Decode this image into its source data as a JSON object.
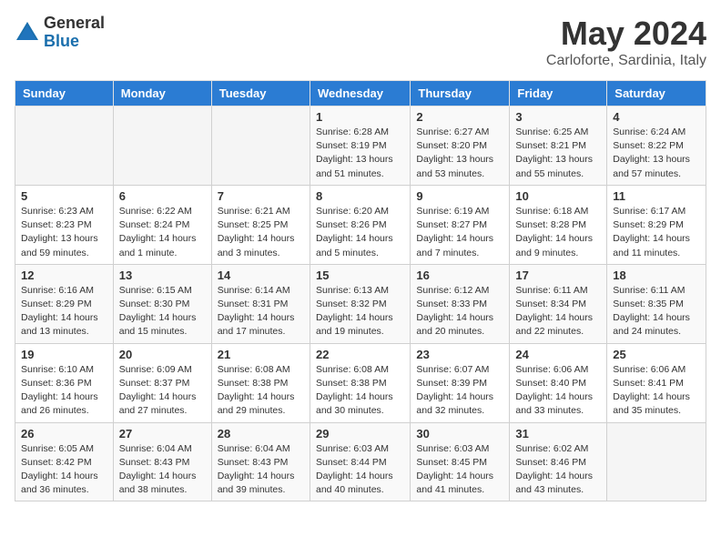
{
  "logo": {
    "general": "General",
    "blue": "Blue"
  },
  "header": {
    "month": "May 2024",
    "location": "Carloforte, Sardinia, Italy"
  },
  "weekdays": [
    "Sunday",
    "Monday",
    "Tuesday",
    "Wednesday",
    "Thursday",
    "Friday",
    "Saturday"
  ],
  "weeks": [
    [
      {
        "day": "",
        "info": ""
      },
      {
        "day": "",
        "info": ""
      },
      {
        "day": "",
        "info": ""
      },
      {
        "day": "1",
        "info": "Sunrise: 6:28 AM\nSunset: 8:19 PM\nDaylight: 13 hours\nand 51 minutes."
      },
      {
        "day": "2",
        "info": "Sunrise: 6:27 AM\nSunset: 8:20 PM\nDaylight: 13 hours\nand 53 minutes."
      },
      {
        "day": "3",
        "info": "Sunrise: 6:25 AM\nSunset: 8:21 PM\nDaylight: 13 hours\nand 55 minutes."
      },
      {
        "day": "4",
        "info": "Sunrise: 6:24 AM\nSunset: 8:22 PM\nDaylight: 13 hours\nand 57 minutes."
      }
    ],
    [
      {
        "day": "5",
        "info": "Sunrise: 6:23 AM\nSunset: 8:23 PM\nDaylight: 13 hours\nand 59 minutes."
      },
      {
        "day": "6",
        "info": "Sunrise: 6:22 AM\nSunset: 8:24 PM\nDaylight: 14 hours\nand 1 minute."
      },
      {
        "day": "7",
        "info": "Sunrise: 6:21 AM\nSunset: 8:25 PM\nDaylight: 14 hours\nand 3 minutes."
      },
      {
        "day": "8",
        "info": "Sunrise: 6:20 AM\nSunset: 8:26 PM\nDaylight: 14 hours\nand 5 minutes."
      },
      {
        "day": "9",
        "info": "Sunrise: 6:19 AM\nSunset: 8:27 PM\nDaylight: 14 hours\nand 7 minutes."
      },
      {
        "day": "10",
        "info": "Sunrise: 6:18 AM\nSunset: 8:28 PM\nDaylight: 14 hours\nand 9 minutes."
      },
      {
        "day": "11",
        "info": "Sunrise: 6:17 AM\nSunset: 8:29 PM\nDaylight: 14 hours\nand 11 minutes."
      }
    ],
    [
      {
        "day": "12",
        "info": "Sunrise: 6:16 AM\nSunset: 8:29 PM\nDaylight: 14 hours\nand 13 minutes."
      },
      {
        "day": "13",
        "info": "Sunrise: 6:15 AM\nSunset: 8:30 PM\nDaylight: 14 hours\nand 15 minutes."
      },
      {
        "day": "14",
        "info": "Sunrise: 6:14 AM\nSunset: 8:31 PM\nDaylight: 14 hours\nand 17 minutes."
      },
      {
        "day": "15",
        "info": "Sunrise: 6:13 AM\nSunset: 8:32 PM\nDaylight: 14 hours\nand 19 minutes."
      },
      {
        "day": "16",
        "info": "Sunrise: 6:12 AM\nSunset: 8:33 PM\nDaylight: 14 hours\nand 20 minutes."
      },
      {
        "day": "17",
        "info": "Sunrise: 6:11 AM\nSunset: 8:34 PM\nDaylight: 14 hours\nand 22 minutes."
      },
      {
        "day": "18",
        "info": "Sunrise: 6:11 AM\nSunset: 8:35 PM\nDaylight: 14 hours\nand 24 minutes."
      }
    ],
    [
      {
        "day": "19",
        "info": "Sunrise: 6:10 AM\nSunset: 8:36 PM\nDaylight: 14 hours\nand 26 minutes."
      },
      {
        "day": "20",
        "info": "Sunrise: 6:09 AM\nSunset: 8:37 PM\nDaylight: 14 hours\nand 27 minutes."
      },
      {
        "day": "21",
        "info": "Sunrise: 6:08 AM\nSunset: 8:38 PM\nDaylight: 14 hours\nand 29 minutes."
      },
      {
        "day": "22",
        "info": "Sunrise: 6:08 AM\nSunset: 8:38 PM\nDaylight: 14 hours\nand 30 minutes."
      },
      {
        "day": "23",
        "info": "Sunrise: 6:07 AM\nSunset: 8:39 PM\nDaylight: 14 hours\nand 32 minutes."
      },
      {
        "day": "24",
        "info": "Sunrise: 6:06 AM\nSunset: 8:40 PM\nDaylight: 14 hours\nand 33 minutes."
      },
      {
        "day": "25",
        "info": "Sunrise: 6:06 AM\nSunset: 8:41 PM\nDaylight: 14 hours\nand 35 minutes."
      }
    ],
    [
      {
        "day": "26",
        "info": "Sunrise: 6:05 AM\nSunset: 8:42 PM\nDaylight: 14 hours\nand 36 minutes."
      },
      {
        "day": "27",
        "info": "Sunrise: 6:04 AM\nSunset: 8:43 PM\nDaylight: 14 hours\nand 38 minutes."
      },
      {
        "day": "28",
        "info": "Sunrise: 6:04 AM\nSunset: 8:43 PM\nDaylight: 14 hours\nand 39 minutes."
      },
      {
        "day": "29",
        "info": "Sunrise: 6:03 AM\nSunset: 8:44 PM\nDaylight: 14 hours\nand 40 minutes."
      },
      {
        "day": "30",
        "info": "Sunrise: 6:03 AM\nSunset: 8:45 PM\nDaylight: 14 hours\nand 41 minutes."
      },
      {
        "day": "31",
        "info": "Sunrise: 6:02 AM\nSunset: 8:46 PM\nDaylight: 14 hours\nand 43 minutes."
      },
      {
        "day": "",
        "info": ""
      }
    ]
  ]
}
